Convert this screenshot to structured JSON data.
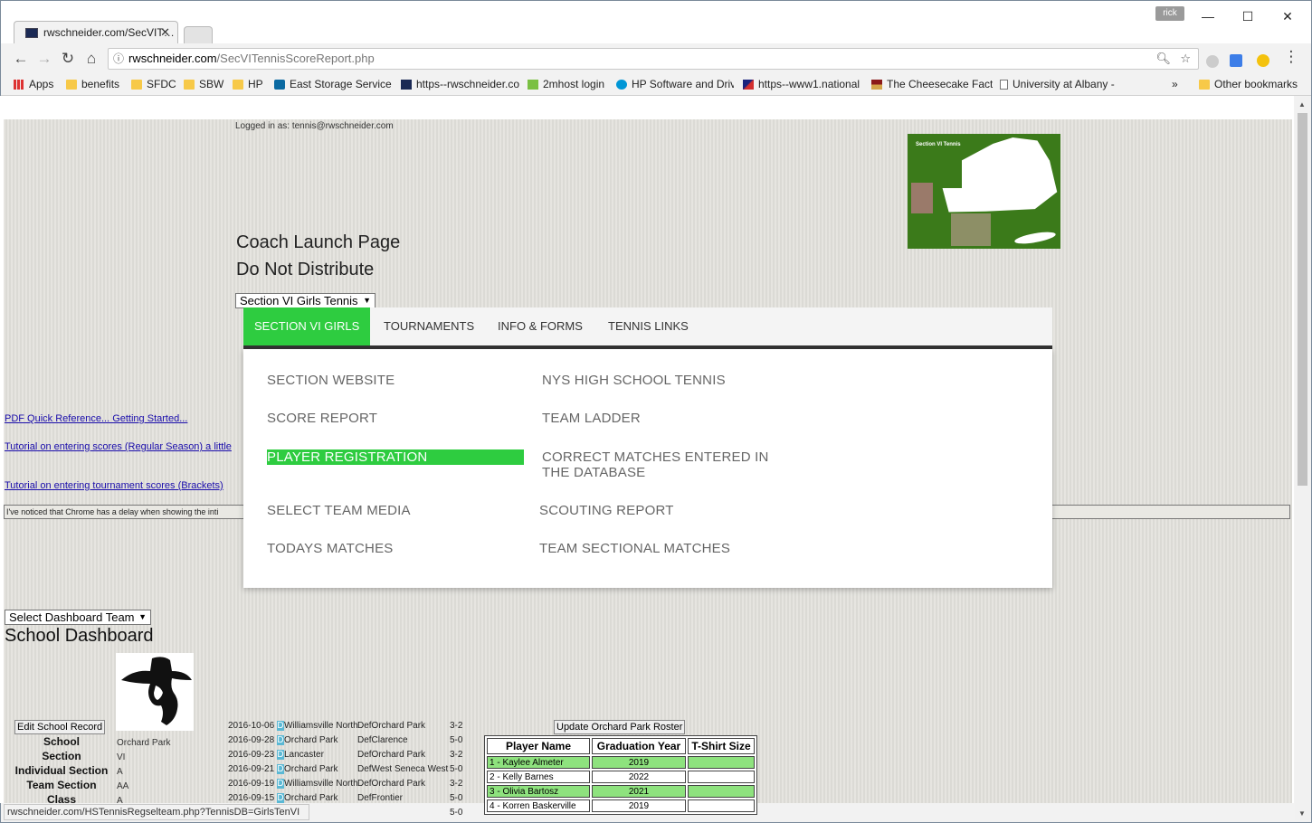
{
  "browser": {
    "tab_title": "rwschneider.com/SecVIT…",
    "tab_close": "✕",
    "profile": "rick",
    "window_controls": {
      "minimize": "—",
      "maximize": "☐",
      "close": "✕"
    },
    "nav": {
      "back": "←",
      "forward": "→",
      "reload": "↻",
      "home": "⌂"
    },
    "url_host": "rwschneider.com",
    "url_path": "/SecVITennisScoreReport.php",
    "bookmarks": [
      {
        "label": "Apps",
        "icon": "apps-icon"
      },
      {
        "label": "benefits",
        "icon": "folder-icon"
      },
      {
        "label": "SFDC",
        "icon": "folder-icon"
      },
      {
        "label": "SBW",
        "icon": "folder-icon"
      },
      {
        "label": "HP",
        "icon": "folder-icon"
      },
      {
        "label": "East Storage Services",
        "icon": "sharepoint-icon"
      },
      {
        "label": "https--rwschneider.co",
        "icon": "site-icon"
      },
      {
        "label": "2mhost login",
        "icon": "2m-icon"
      },
      {
        "label": "HP Software and Driv",
        "icon": "hp-icon"
      },
      {
        "label": "https--www1.national",
        "icon": "flag-icon"
      },
      {
        "label": "The Cheesecake Facto",
        "icon": "cheesecake-icon"
      },
      {
        "label": "University at Albany -",
        "icon": "page-icon"
      }
    ],
    "bookmarks_overflow": "»",
    "other_bookmarks": "Other bookmarks",
    "status_url": "rwschneider.com/HSTennisRegselteam.php?TennisDB=GirlsTenVI"
  },
  "page": {
    "logged_in": "Logged in as: tennis@rwschneider.com",
    "map_label": "Section VI Tennis",
    "title": "Coach Launch Page",
    "subtitle": "Do Not Distribute",
    "section_select": "Section VI Girls Tennis",
    "left_links": [
      "PDF Quick Reference... Getting Started...",
      "Tutorial on entering scores (Regular Season) a little",
      "Tutorial on entering tournament scores (Brackets)"
    ],
    "chrome_note": "I've noticed that Chrome has a delay when showing the inti",
    "menu": {
      "tabs": [
        "SECTION VI GIRLS",
        "TOURNAMENTS",
        "INFO & FORMS",
        "TENNIS LINKS"
      ],
      "left_items": [
        "SECTION WEBSITE",
        "SCORE REPORT",
        "PLAYER REGISTRATION",
        "SELECT TEAM MEDIA",
        "TODAYS MATCHES"
      ],
      "right_items": [
        "NYS HIGH SCHOOL TENNIS",
        "TEAM LADDER",
        "CORRECT MATCHES ENTERED IN THE DATABASE",
        "SCOUTING REPORT",
        "TEAM SECTIONAL MATCHES"
      ],
      "highlighted": "PLAYER REGISTRATION"
    },
    "dashboard": {
      "team_select": "Select Dashboard Team",
      "title": "School Dashboard",
      "edit_button": "Edit School Record",
      "update_button": "Update Orchard Park Roster",
      "fields": [
        {
          "label": "School",
          "value": "Orchard Park"
        },
        {
          "label": "Section",
          "value": "VI"
        },
        {
          "label": "Individual Section",
          "value": "A"
        },
        {
          "label": "Team Section",
          "value": "AA"
        },
        {
          "label": "Class",
          "value": "A"
        }
      ],
      "matches": [
        {
          "date": "2016-10-06",
          "result": "D",
          "team": "Williamsville North",
          "defeated": "DefOrchard Park",
          "score": "3-2"
        },
        {
          "date": "2016-09-28",
          "result": "D",
          "team": "Orchard Park",
          "defeated": "DefClarence",
          "score": "5-0"
        },
        {
          "date": "2016-09-23",
          "result": "D",
          "team": "Lancaster",
          "defeated": "DefOrchard Park",
          "score": "3-2"
        },
        {
          "date": "2016-09-21",
          "result": "D",
          "team": "Orchard Park",
          "defeated": "DefWest Seneca West",
          "score": "5-0"
        },
        {
          "date": "2016-09-19",
          "result": "D",
          "team": "Williamsville North",
          "defeated": "DefOrchard Park",
          "score": "3-2"
        },
        {
          "date": "2016-09-15",
          "result": "D",
          "team": "Orchard Park",
          "defeated": "DefFrontier",
          "score": "5-0"
        },
        {
          "date": "",
          "result": "",
          "team": "",
          "defeated": "",
          "score": "5-0"
        }
      ],
      "roster_headers": [
        "Player Name",
        "Graduation Year",
        "T-Shirt Size"
      ],
      "roster": [
        {
          "name": "1 - Kaylee Almeter",
          "year": "2019",
          "shirt": ""
        },
        {
          "name": "2 - Kelly Barnes",
          "year": "2022",
          "shirt": ""
        },
        {
          "name": "3 - Olivia Bartosz",
          "year": "2021",
          "shirt": ""
        },
        {
          "name": "4 - Korren Baskerville",
          "year": "2019",
          "shirt": ""
        }
      ]
    }
  },
  "colors": {
    "accent_green": "#2ecc40",
    "roster_green": "#8ee27e",
    "result_blue": "#5bb8d4",
    "page_bg": "#e2e1dc"
  }
}
